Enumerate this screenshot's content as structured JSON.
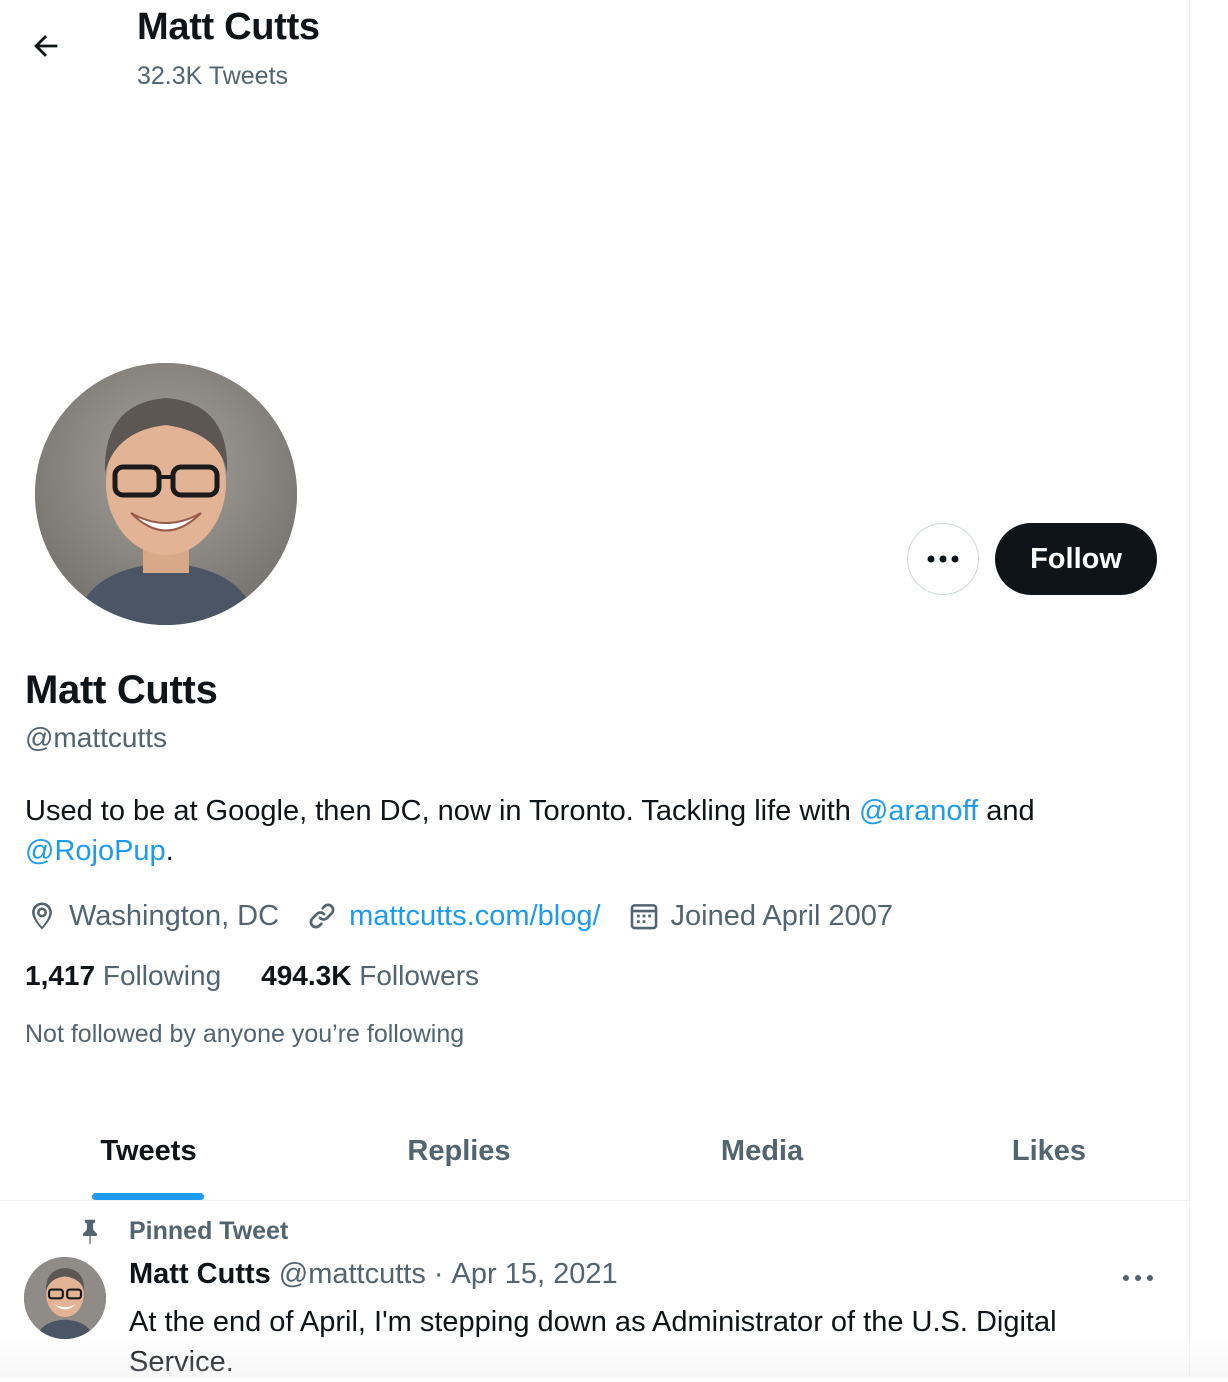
{
  "header": {
    "name": "Matt Cutts",
    "tweet_count": "32.3K Tweets"
  },
  "profile": {
    "name": "Matt Cutts",
    "handle": "@mattcutts",
    "more_label": "...",
    "follow_label": "Follow",
    "bio": {
      "text1": "Used to be at Google, then DC, now in Toronto. Tackling life with ",
      "mention1": "@aranoff",
      "text2": " and ",
      "mention2": "@RojoPup",
      "text3": "."
    },
    "location": "Washington, DC",
    "website": "mattcutts.com/blog/",
    "joined": "Joined April 2007",
    "following_count": "1,417",
    "following_label": "Following",
    "followers_count": "494.3K",
    "followers_label": "Followers",
    "not_followed": "Not followed by anyone you’re following"
  },
  "tabs": [
    {
      "label": "Tweets",
      "active": true
    },
    {
      "label": "Replies",
      "active": false
    },
    {
      "label": "Media",
      "active": false
    },
    {
      "label": "Likes",
      "active": false
    }
  ],
  "pinned_tweet": {
    "pinned_label": "Pinned Tweet",
    "author": "Matt Cutts",
    "handle": "@mattcutts",
    "separator": "·",
    "date": "Apr 15, 2021",
    "text": "At the end of April, I'm stepping down as Administrator of the U.S. Digital Service."
  },
  "colors": {
    "accent": "#1d9bf0",
    "text": "#0f1419",
    "secondary": "#536471",
    "button": "#0f1419"
  },
  "icons": [
    "back-arrow-icon",
    "more-icon",
    "location-icon",
    "link-icon",
    "calendar-icon",
    "pin-icon"
  ]
}
